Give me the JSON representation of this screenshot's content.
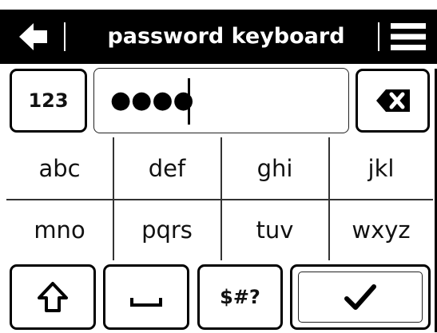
{
  "header": {
    "title": "password keyboard",
    "back_icon": "arrow-left-icon",
    "menu_icon": "hamburger-menu-icon"
  },
  "top_row": {
    "mode_label": "123",
    "password_masked": "●●●●",
    "backspace_icon": "backspace-icon"
  },
  "keys": {
    "row1": [
      "abc",
      "def",
      "ghi",
      "jkl"
    ],
    "row2": [
      "mno",
      "pqrs",
      "tuv",
      "wxyz"
    ]
  },
  "bottom_row": {
    "shift_icon": "shift-arrow-icon",
    "space_icon": "space-bar-icon",
    "symbols_label": "$#?",
    "confirm_icon": "checkmark-icon"
  },
  "colors": {
    "header_bg": "#000000",
    "header_text": "#ffffff",
    "key_border": "#000000",
    "background": "#ffffff"
  }
}
